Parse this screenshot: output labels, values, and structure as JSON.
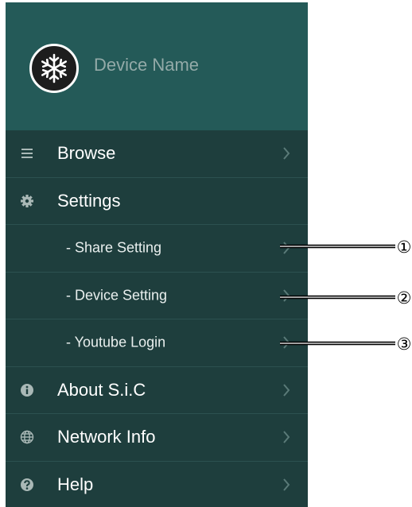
{
  "header": {
    "device_name": "Device Name",
    "avatar_icon": "snowflake-icon"
  },
  "menu": {
    "browse": "Browse",
    "settings": "Settings",
    "share_setting": "- Share Setting",
    "device_setting": "- Device Setting",
    "youtube_login": "- Youtube Login",
    "about": "About S.i.C",
    "network_info": "Network Info",
    "help": "Help"
  },
  "callouts": [
    "①",
    "②",
    "③"
  ],
  "colors": {
    "drawer_bg": "#1e3e3d",
    "header_bg": "#245a58",
    "divider": "#2c5150",
    "icon": "#a9b8b6",
    "chevron": "#5a7a78"
  }
}
